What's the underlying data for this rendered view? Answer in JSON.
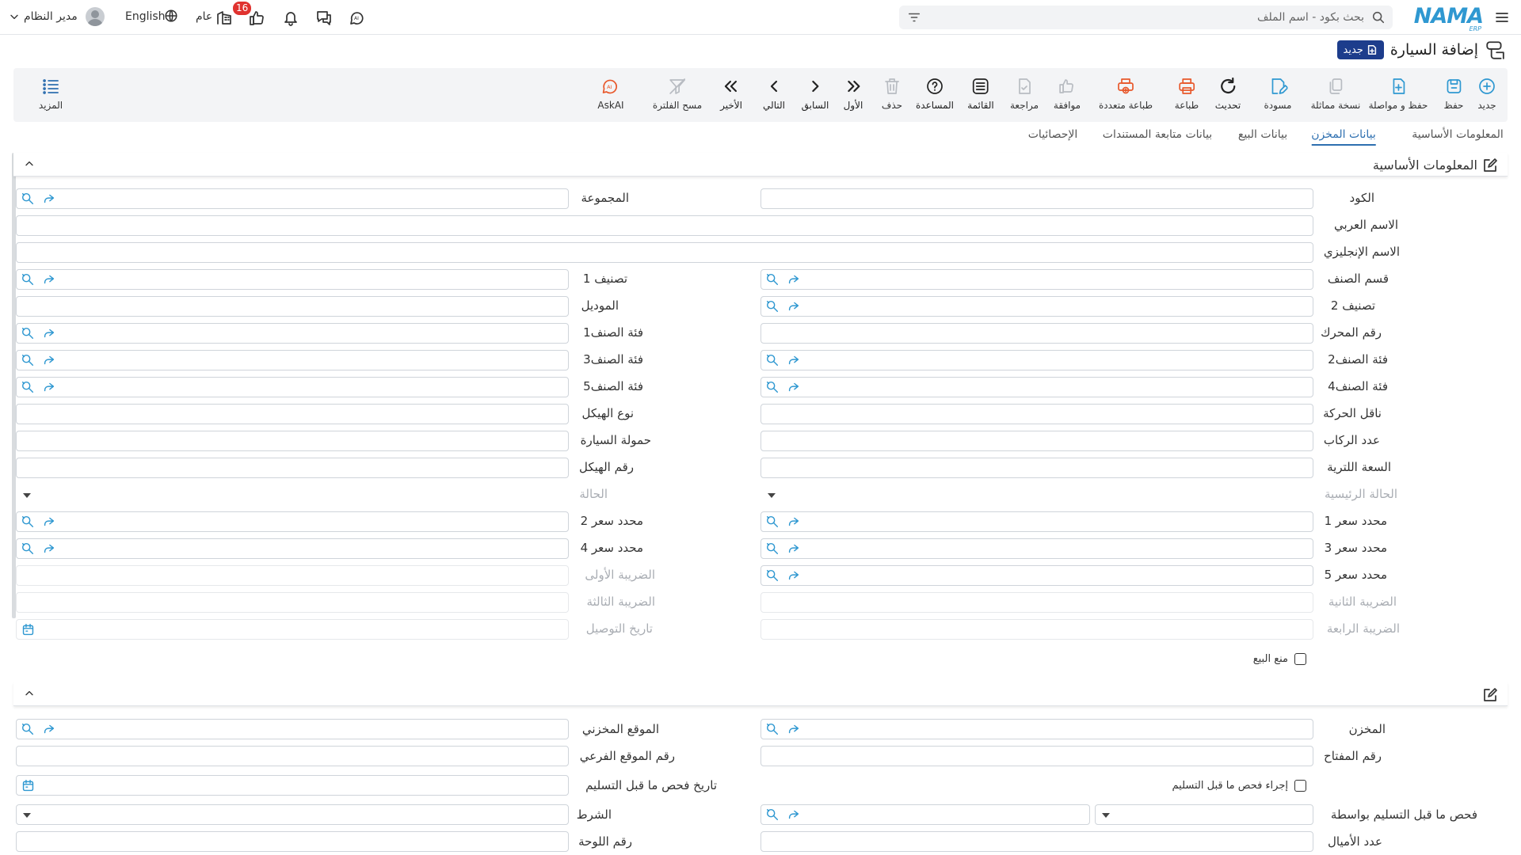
{
  "header": {
    "logo_text": "NAMA",
    "logo_sub": "ERP",
    "search_placeholder": "بحث بكود - اسم الملف",
    "notification_count": "16",
    "branch": "عام",
    "language": "English",
    "user": "مدير النظام"
  },
  "page": {
    "title": "إضافة السيارة",
    "new_badge": "جديد"
  },
  "toolbar": {
    "new": "جديد",
    "save": "حفظ",
    "save_continue": "حفظ و مواصلة",
    "copy": "نسخة مماثلة",
    "draft": "مسودة",
    "refresh": "تحديث",
    "print": "طباعة",
    "multi_print": "طباعة متعددة",
    "approve": "موافقة",
    "review": "مراجعة",
    "list": "القائمة",
    "help": "المساعدة",
    "delete": "حذف",
    "first": "الأول",
    "previous": "السابق",
    "next": "التالي",
    "last": "الأخير",
    "clear_filter": "مسح الفلترة",
    "askai": "AskAI",
    "more": "المزيد"
  },
  "tabs": [
    "المعلومات الأساسية",
    "بيانات المخزن",
    "بيانات البيع",
    "بيانات متابعة المستندات",
    "الإحصائيات"
  ],
  "active_tab": 1,
  "section1": {
    "title": "المعلومات الأساسية",
    "fields": {
      "code": "الكود",
      "group": "المجموعة",
      "arabic_name": "الاسم العربي",
      "english_name": "الاسم الإنجليزي",
      "item_section": "قسم الصنف",
      "class1": "تصنيف 1",
      "class2": "تصنيف 2",
      "model": "الموديل",
      "engine_no": "رقم المحرك",
      "item_cat1": "فئة الصنف1",
      "item_cat2": "فئة الصنف2",
      "item_cat3": "فئة الصنف3",
      "item_cat4": "فئة الصنف4",
      "item_cat5": "فئة الصنف5",
      "transmission": "ناقل الحركة",
      "body_type": "نوع الهيكل",
      "passengers": "عدد الركاب",
      "load": "حمولة السيارة",
      "liter_capacity": "السعة اللترية",
      "chassis_no": "رقم الهيكل",
      "main_status": "الحالة الرئيسية",
      "status": "الحالة",
      "price1": "محدد سعر 1",
      "price2": "محدد سعر 2",
      "price3": "محدد سعر 3",
      "price4": "محدد سعر 4",
      "price5": "محدد سعر 5",
      "tax1": "الضريبة الأولى",
      "tax2": "الضريبة الثانية",
      "tax3": "الضريبة الثالثة",
      "tax4": "الضريبة الرابعة",
      "delivery_date": "تاريخ التوصيل",
      "prevent_sale": "منع البيع"
    }
  },
  "section2": {
    "fields": {
      "warehouse": "المخزن",
      "storage_location": "الموقع المخزني",
      "key_no": "رقم المفتاح",
      "sub_location_no": "رقم الموقع الفرعي",
      "pre_delivery_check": "إجراء فحص ما قبل التسليم",
      "pre_delivery_date": "تاريخ فحص ما قبل التسليم",
      "pre_delivery_by": "فحص ما قبل التسليم بواسطة",
      "condition": "الشرط",
      "mileage": "عدد الأميال",
      "plate_no": "رقم اللوحة"
    }
  },
  "colors": {
    "accent": "#2f98d1",
    "badge_bg": "#1d3d8c",
    "notif_red": "#e0322f",
    "print_orange": "#e8582b"
  }
}
